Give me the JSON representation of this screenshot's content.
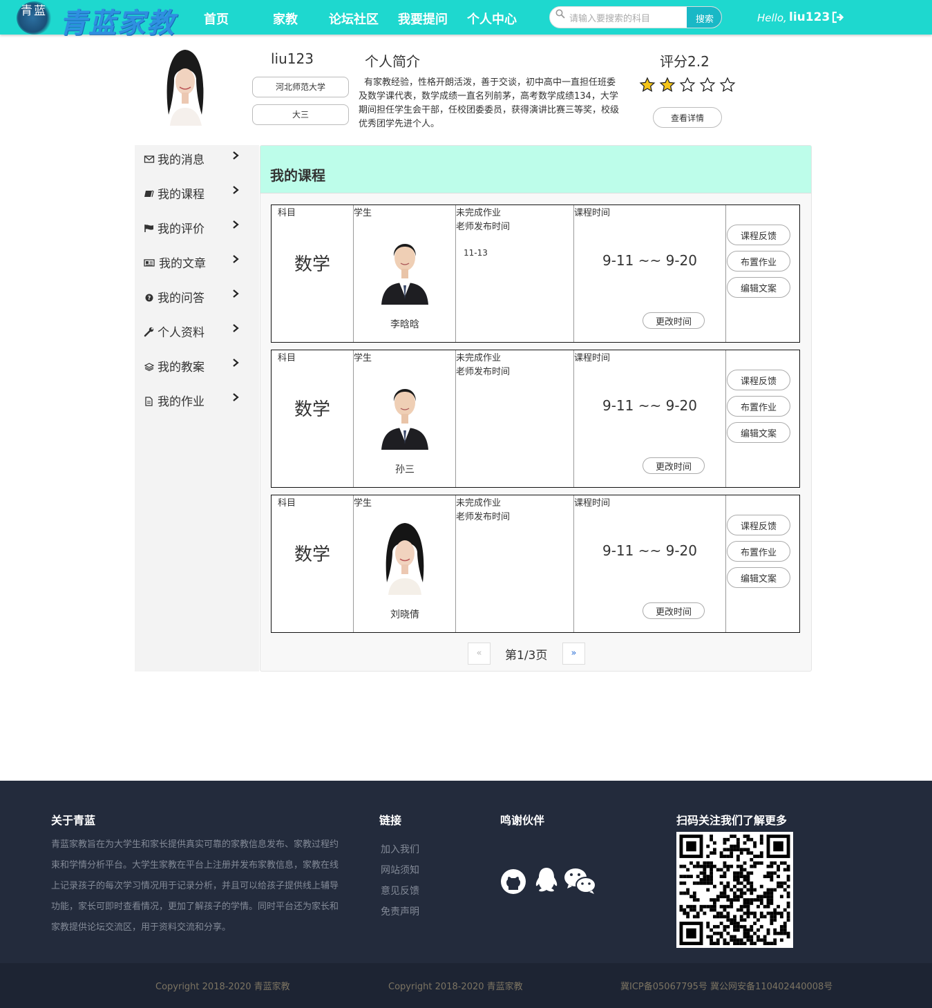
{
  "nav": {
    "logo_mark": "青蓝",
    "logo_text": "青蓝家教",
    "links": [
      "首页",
      "家教",
      "论坛社区",
      "我要提问",
      "个人中心"
    ],
    "search_placeholder": "请输入要搜索的科目",
    "search_button": "搜索",
    "hello": "Hello,",
    "username": "liu123"
  },
  "profile": {
    "name": "liu123",
    "school": "河北师范大学",
    "grade": "大三",
    "intro_title": "个人简介",
    "intro_text": "有家教经验，性格开朗活泼，善于交谈，初中高中一直担任班委及数学课代表，数学成绩一直名列前茅，高考数学成绩134，大学期间担任学生会干部，任校团委委员，获得演讲比赛三等奖，校级优秀团学先进个人。",
    "score_label": "评分2.2",
    "rating": 2,
    "rating_max": 5,
    "detail_button": "查看详情"
  },
  "sidebar": {
    "items": [
      {
        "label": "我的消息",
        "icon": "envelope-icon"
      },
      {
        "label": "我的课程",
        "icon": "book-icon"
      },
      {
        "label": "我的评价",
        "icon": "flag-icon"
      },
      {
        "label": "我的文章",
        "icon": "newspaper-icon"
      },
      {
        "label": "我的问答",
        "icon": "question-circle-icon"
      },
      {
        "label": "个人资料",
        "icon": "wrench-icon"
      },
      {
        "label": "我的教案",
        "icon": "layers-icon"
      },
      {
        "label": "我的作业",
        "icon": "file-icon"
      }
    ]
  },
  "main": {
    "title": "我的课程",
    "headers": {
      "subject": "科目",
      "student": "学生",
      "homework_1": "未完成作业",
      "homework_2": "老师发布时间",
      "time": "课程时间"
    },
    "courses": [
      {
        "subject": "数学",
        "student": "李晗晗",
        "hw_date": "11-13",
        "time": "9-11 ~~ 9-20",
        "photo": "male"
      },
      {
        "subject": "数学",
        "student": "孙三",
        "hw_date": "",
        "time": "9-11 ~~ 9-20",
        "photo": "male"
      },
      {
        "subject": "数学",
        "student": "刘晓倩",
        "hw_date": "",
        "time": "9-11 ~~ 9-20",
        "photo": "female"
      }
    ],
    "change_time_button": "更改时间",
    "actions": [
      "课程反馈",
      "布置作业",
      "编辑文案"
    ],
    "pager": {
      "prev": "«",
      "text": "第1/3页",
      "next": "»"
    }
  },
  "footer": {
    "about_title": "关于青蓝",
    "about_text": "青蓝家教旨在为大学生和家长提供真实可靠的家教信息发布、家教过程约束和学情分析平台。大学生家教在平台上注册并发布家教信息，家教在线上记录孩子的每次学习情况用于记录分析，并且可以给孩子提供线上辅导功能，家长可即时查看情况，更加了解孩子的学情。同时平台还为家长和家教提供论坛交流区，用于资料交流和分享。",
    "links_title": "链接",
    "links": [
      "加入我们",
      "网站须知",
      "意见反馈",
      "免责声明"
    ],
    "partners_title": "鸣谢伙伴",
    "partner_icons": [
      "github-icon",
      "qq-icon",
      "wechat-icon"
    ],
    "qr_title": "扫码关注我们了解更多",
    "copyright_1": "Copyright 2018-2020   青蓝家教",
    "copyright_2": "Copyright 2018-2020   青蓝家教",
    "icp": "冀ICP备05067795号 冀公网安备110402440008号"
  },
  "colors": {
    "nav_bg": "#1ed8cf",
    "panel_head": "#bdfdea",
    "footer_bg": "#232b3c",
    "star": "#f5c518"
  }
}
